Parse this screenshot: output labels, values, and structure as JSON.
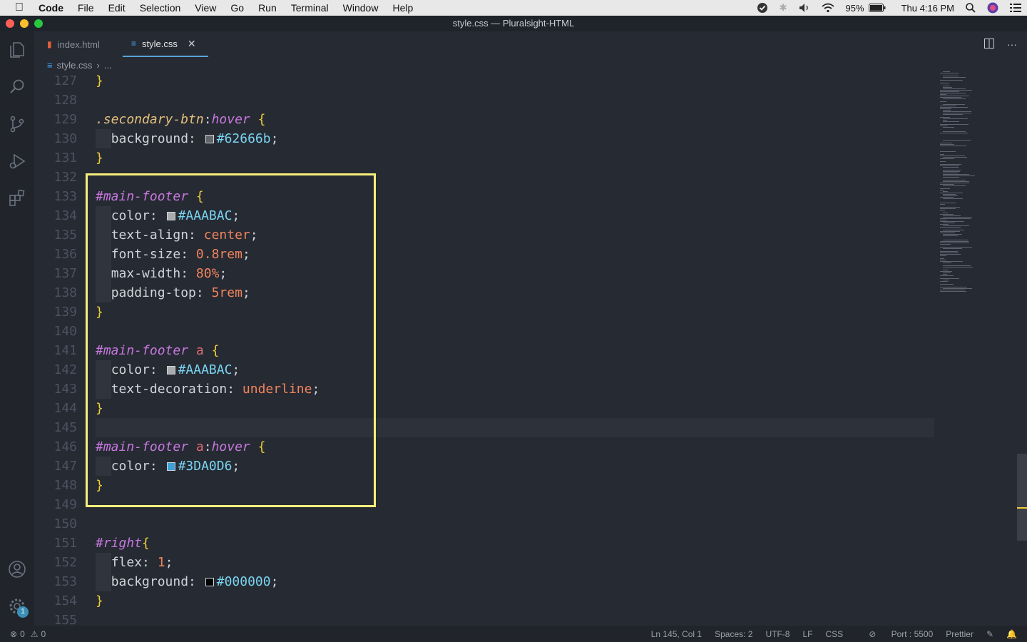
{
  "menubar": {
    "app_name": "Code",
    "items": [
      "File",
      "Edit",
      "Selection",
      "View",
      "Go",
      "Run",
      "Terminal",
      "Window",
      "Help"
    ],
    "battery": "95%",
    "clock": "Thu 4:16 PM"
  },
  "window": {
    "title": "style.css — Pluralsight-HTML"
  },
  "tabs": [
    {
      "label": "index.html",
      "active": false,
      "icon": "html-file-icon"
    },
    {
      "label": "style.css",
      "active": true,
      "icon": "css-file-icon"
    }
  ],
  "breadcrumb": {
    "file": "style.css",
    "more": "..."
  },
  "activity": {
    "settings_badge": "1"
  },
  "code_lines": [
    {
      "n": "127",
      "t": "}"
    },
    {
      "n": "128",
      "t": ""
    },
    {
      "n": "129",
      "t": ".secondary-btn:hover {"
    },
    {
      "n": "130",
      "t": "  background: #62666b;"
    },
    {
      "n": "131",
      "t": "}"
    },
    {
      "n": "132",
      "t": ""
    },
    {
      "n": "133",
      "t": "#main-footer {"
    },
    {
      "n": "134",
      "t": "  color: #AAABAC;"
    },
    {
      "n": "135",
      "t": "  text-align: center;"
    },
    {
      "n": "136",
      "t": "  font-size: 0.8rem;"
    },
    {
      "n": "137",
      "t": "  max-width: 80%;"
    },
    {
      "n": "138",
      "t": "  padding-top: 5rem;"
    },
    {
      "n": "139",
      "t": "}"
    },
    {
      "n": "140",
      "t": ""
    },
    {
      "n": "141",
      "t": "#main-footer a {"
    },
    {
      "n": "142",
      "t": "  color: #AAABAC;"
    },
    {
      "n": "143",
      "t": "  text-decoration: underline;"
    },
    {
      "n": "144",
      "t": "}"
    },
    {
      "n": "145",
      "t": ""
    },
    {
      "n": "146",
      "t": "#main-footer a:hover {"
    },
    {
      "n": "147",
      "t": "  color: #3DA0D6;"
    },
    {
      "n": "148",
      "t": "}"
    },
    {
      "n": "149",
      "t": ""
    },
    {
      "n": "150",
      "t": ""
    },
    {
      "n": "151",
      "t": "#right{"
    },
    {
      "n": "152",
      "t": "  flex: 1;"
    },
    {
      "n": "153",
      "t": "  background: #000000;"
    },
    {
      "n": "154",
      "t": "}"
    },
    {
      "n": "155",
      "t": ""
    }
  ],
  "colors": {
    "swatch_62666b": "#62666b",
    "swatch_AAABAC": "#AAABAC",
    "swatch_3DA0D6": "#3DA0D6",
    "swatch_000000": "#000000",
    "highlight": "#f7ef7b"
  },
  "statusbar": {
    "errors": "0",
    "warnings": "0",
    "position": "Ln 145, Col 1",
    "spaces": "Spaces: 2",
    "encoding": "UTF-8",
    "eol": "LF",
    "language": "CSS",
    "port": "Port : 5500",
    "formatter": "Prettier"
  }
}
